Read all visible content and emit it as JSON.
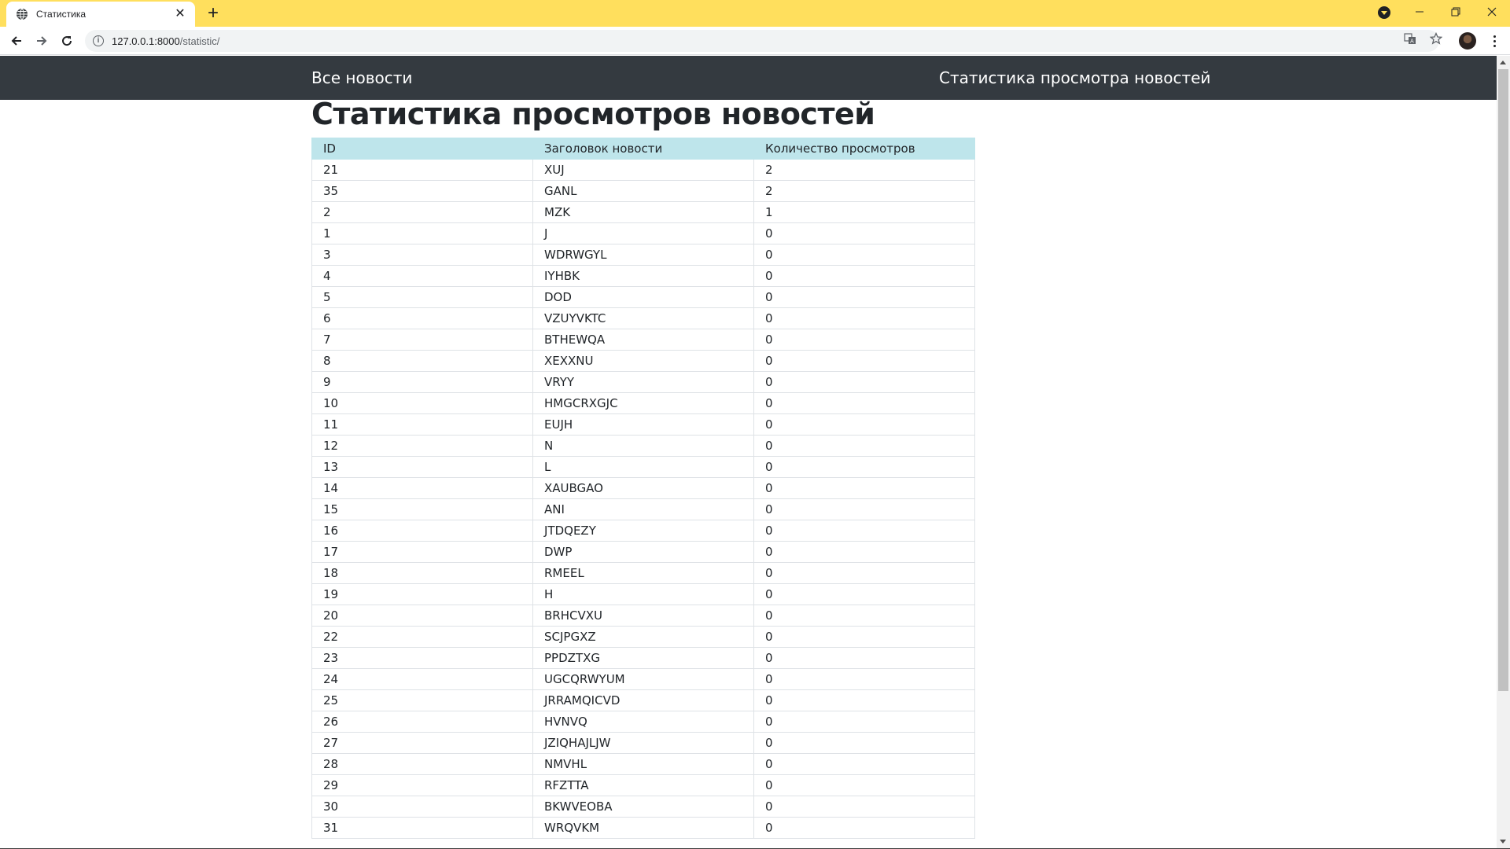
{
  "browser": {
    "tab_title": "Статистика",
    "tab_close": "✕",
    "new_tab": "+",
    "url_host": "127.0.0.1:8000",
    "url_path": "/statistic/",
    "icons": [
      "globe-icon",
      "back-icon",
      "forward-icon",
      "reload-icon",
      "info-icon",
      "translate-icon",
      "star-icon",
      "avatar",
      "menu-icon",
      "minimize-icon",
      "restore-icon",
      "close-icon"
    ]
  },
  "nav": {
    "all_news": "Все новости",
    "stats": "Статистика просмотра новостей"
  },
  "page": {
    "title": "Статистика просмотров новостей"
  },
  "table": {
    "headers": [
      "ID",
      "Заголовок новости",
      "Количество просмотров"
    ],
    "rows": [
      [
        "21",
        "XUJ",
        "2"
      ],
      [
        "35",
        "GANL",
        "2"
      ],
      [
        "2",
        "MZK",
        "1"
      ],
      [
        "1",
        "J",
        "0"
      ],
      [
        "3",
        "WDRWGYL",
        "0"
      ],
      [
        "4",
        "IYHBK",
        "0"
      ],
      [
        "5",
        "DOD",
        "0"
      ],
      [
        "6",
        "VZUYVKTC",
        "0"
      ],
      [
        "7",
        "BTHEWQA",
        "0"
      ],
      [
        "8",
        "XEXXNU",
        "0"
      ],
      [
        "9",
        "VRYY",
        "0"
      ],
      [
        "10",
        "HMGCRXGJC",
        "0"
      ],
      [
        "11",
        "EUJH",
        "0"
      ],
      [
        "12",
        "N",
        "0"
      ],
      [
        "13",
        "L",
        "0"
      ],
      [
        "14",
        "XAUBGAO",
        "0"
      ],
      [
        "15",
        "ANI",
        "0"
      ],
      [
        "16",
        "JTDQEZY",
        "0"
      ],
      [
        "17",
        "DWP",
        "0"
      ],
      [
        "18",
        "RMEEL",
        "0"
      ],
      [
        "19",
        "H",
        "0"
      ],
      [
        "20",
        "BRHCVXU",
        "0"
      ],
      [
        "22",
        "SCJPGXZ",
        "0"
      ],
      [
        "23",
        "PPDZTXG",
        "0"
      ],
      [
        "24",
        "UGCQRWYUM",
        "0"
      ],
      [
        "25",
        "JRRAMQICVD",
        "0"
      ],
      [
        "26",
        "HVNVQ",
        "0"
      ],
      [
        "27",
        "JZIQHAJLJW",
        "0"
      ],
      [
        "28",
        "NMVHL",
        "0"
      ],
      [
        "29",
        "RFZTTA",
        "0"
      ],
      [
        "30",
        "BKWVEOBA",
        "0"
      ],
      [
        "31",
        "WRQVKM",
        "0"
      ]
    ]
  }
}
